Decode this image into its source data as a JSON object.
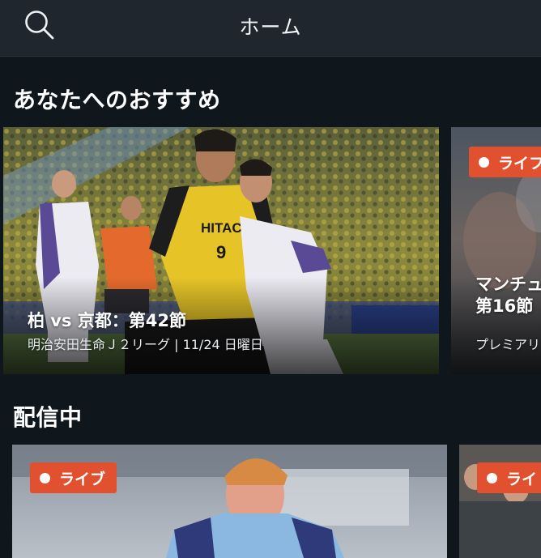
{
  "header": {
    "title": "ホーム"
  },
  "icons": {
    "search": "search-icon"
  },
  "colors": {
    "header_bg": "#1f262e",
    "page_bg": "#0f161c",
    "live_badge": "#e1512f",
    "jersey_yellow": "#e6c428"
  },
  "sections": [
    {
      "title": "あなたへのおすすめ",
      "cards": [
        {
          "title": "柏 vs 京都：第42節",
          "subtitle": "明治安田生命Ｊ２リーグ | 11/24 日曜日",
          "live": false
        },
        {
          "title_line1": "マンチュ",
          "title_line2": "第16節",
          "subtitle": "プレミアリ",
          "live": true,
          "live_label": "ライブ"
        }
      ]
    },
    {
      "title": "配信中",
      "cards": [
        {
          "live": true,
          "live_label": "ライブ"
        },
        {
          "live": true,
          "live_label": "ライ"
        }
      ]
    }
  ],
  "live_badge_label_peek": "ライフ"
}
